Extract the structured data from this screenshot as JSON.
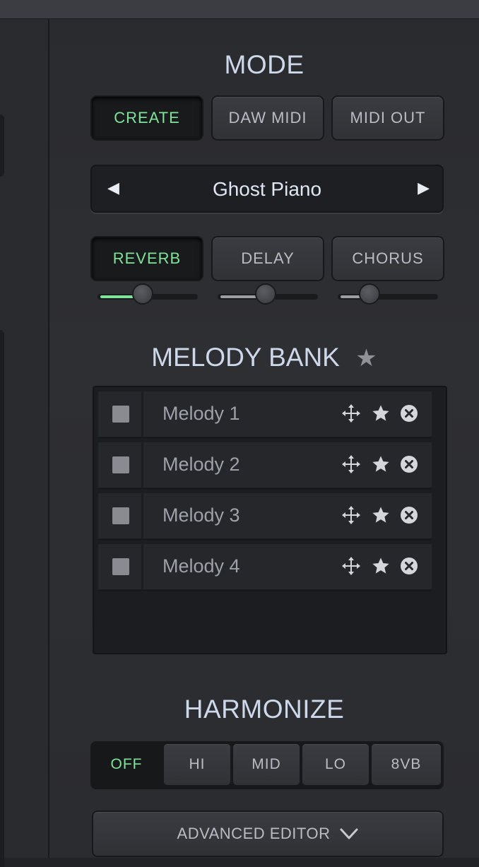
{
  "mode": {
    "heading": "MODE",
    "buttons": [
      "CREATE",
      "DAW MIDI",
      "MIDI OUT"
    ],
    "active": "CREATE"
  },
  "instrument": {
    "name": "Ghost Piano",
    "prev_icon": "◀",
    "next_icon": "▶"
  },
  "effects": {
    "buttons": [
      "REVERB",
      "DELAY",
      "CHORUS"
    ],
    "active": "REVERB",
    "levels": [
      0.45,
      0.48,
      0.32
    ]
  },
  "melody_bank": {
    "heading": "MELODY BANK",
    "star_icon": "★",
    "items": [
      {
        "label": "Melody 1"
      },
      {
        "label": "Melody 2"
      },
      {
        "label": "Melody 3"
      },
      {
        "label": "Melody 4"
      }
    ]
  },
  "harmonize": {
    "heading": "HARMONIZE",
    "options": [
      "OFF",
      "HI",
      "MID",
      "LO",
      "8VB"
    ],
    "active": "OFF"
  },
  "advanced_editor": {
    "label": "ADVANCED EDITOR"
  },
  "colors": {
    "accent_green": "#7fe39a",
    "heading_text": "#cdd8ea"
  }
}
